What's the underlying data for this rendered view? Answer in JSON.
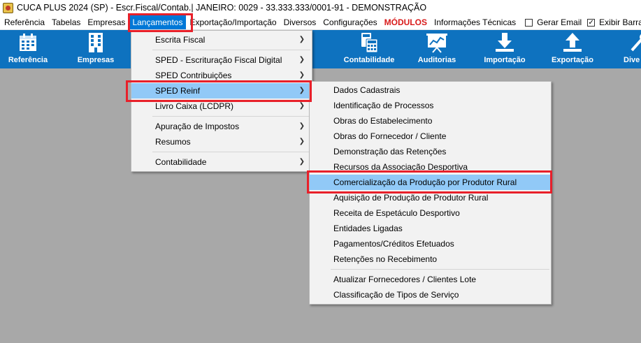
{
  "window": {
    "title": "CUCA PLUS 2024 (SP) - Escr.Fiscal/Contab.| JANEIRO: 0029 - 33.333.333/0001-91 - DEMONSTRAÇÃO"
  },
  "menubar": {
    "items": [
      "Referência",
      "Tabelas",
      "Empresas",
      "Lançamentos",
      "Exportação/Importação",
      "Diversos",
      "Configurações",
      "MÓDULOS",
      "Informações Técnicas"
    ],
    "checks": [
      {
        "label": "Gerar Email",
        "checked": false
      },
      {
        "label": "Exibir Barra",
        "checked": true
      }
    ]
  },
  "toolbar": {
    "buttons": [
      {
        "label": "Referência",
        "icon": "calendar-icon"
      },
      {
        "label": "Empresas",
        "icon": "building-icon"
      },
      {
        "label": "Contabilidade",
        "icon": "calculator-icon"
      },
      {
        "label": "Auditorias",
        "icon": "presentation-chart-icon"
      },
      {
        "label": "Importação",
        "icon": "download-icon"
      },
      {
        "label": "Exportação",
        "icon": "upload-icon"
      },
      {
        "label": "Dive",
        "icon": "tools-icon"
      }
    ]
  },
  "lancamentos_menu": {
    "items": [
      {
        "label": "Escrita Fiscal",
        "submenu": true
      },
      {
        "label": "SPED - Escrituração Fiscal Digital",
        "submenu": true
      },
      {
        "label": "SPED Contribuições",
        "submenu": true
      },
      {
        "label": "SPED Reinf",
        "submenu": true
      },
      {
        "label": "Livro Caixa (LCDPR)",
        "submenu": true
      },
      {
        "label": "Apuração de Impostos",
        "submenu": true
      },
      {
        "label": "Resumos",
        "submenu": true
      },
      {
        "label": "Contabilidade",
        "submenu": true
      }
    ]
  },
  "reinf_menu": {
    "items": [
      "Dados Cadastrais",
      "Identificação de Processos",
      "Obras do Estabelecimento",
      "Obras do Fornecedor / Cliente",
      "Demonstração das Retenções",
      "Recursos da Associação Desportiva",
      "Comercialização da Produção por Produtor Rural",
      "Aquisição de Produção de Produtor Rural",
      "Receita de Espetáculo Desportivo",
      "Entidades Ligadas",
      "Pagamentos/Créditos Efetuados",
      "Retenções no Recebimento",
      "Atualizar Fornecedores / Clientes Lote",
      "Classificação de Tipos de Serviço"
    ]
  },
  "colors": {
    "toolbar": "#0e72bf",
    "highlight": "#91c9f7",
    "active_menu": "#0078d7",
    "annotation_red": "#e8202a",
    "modulos": "#d81a1a"
  }
}
